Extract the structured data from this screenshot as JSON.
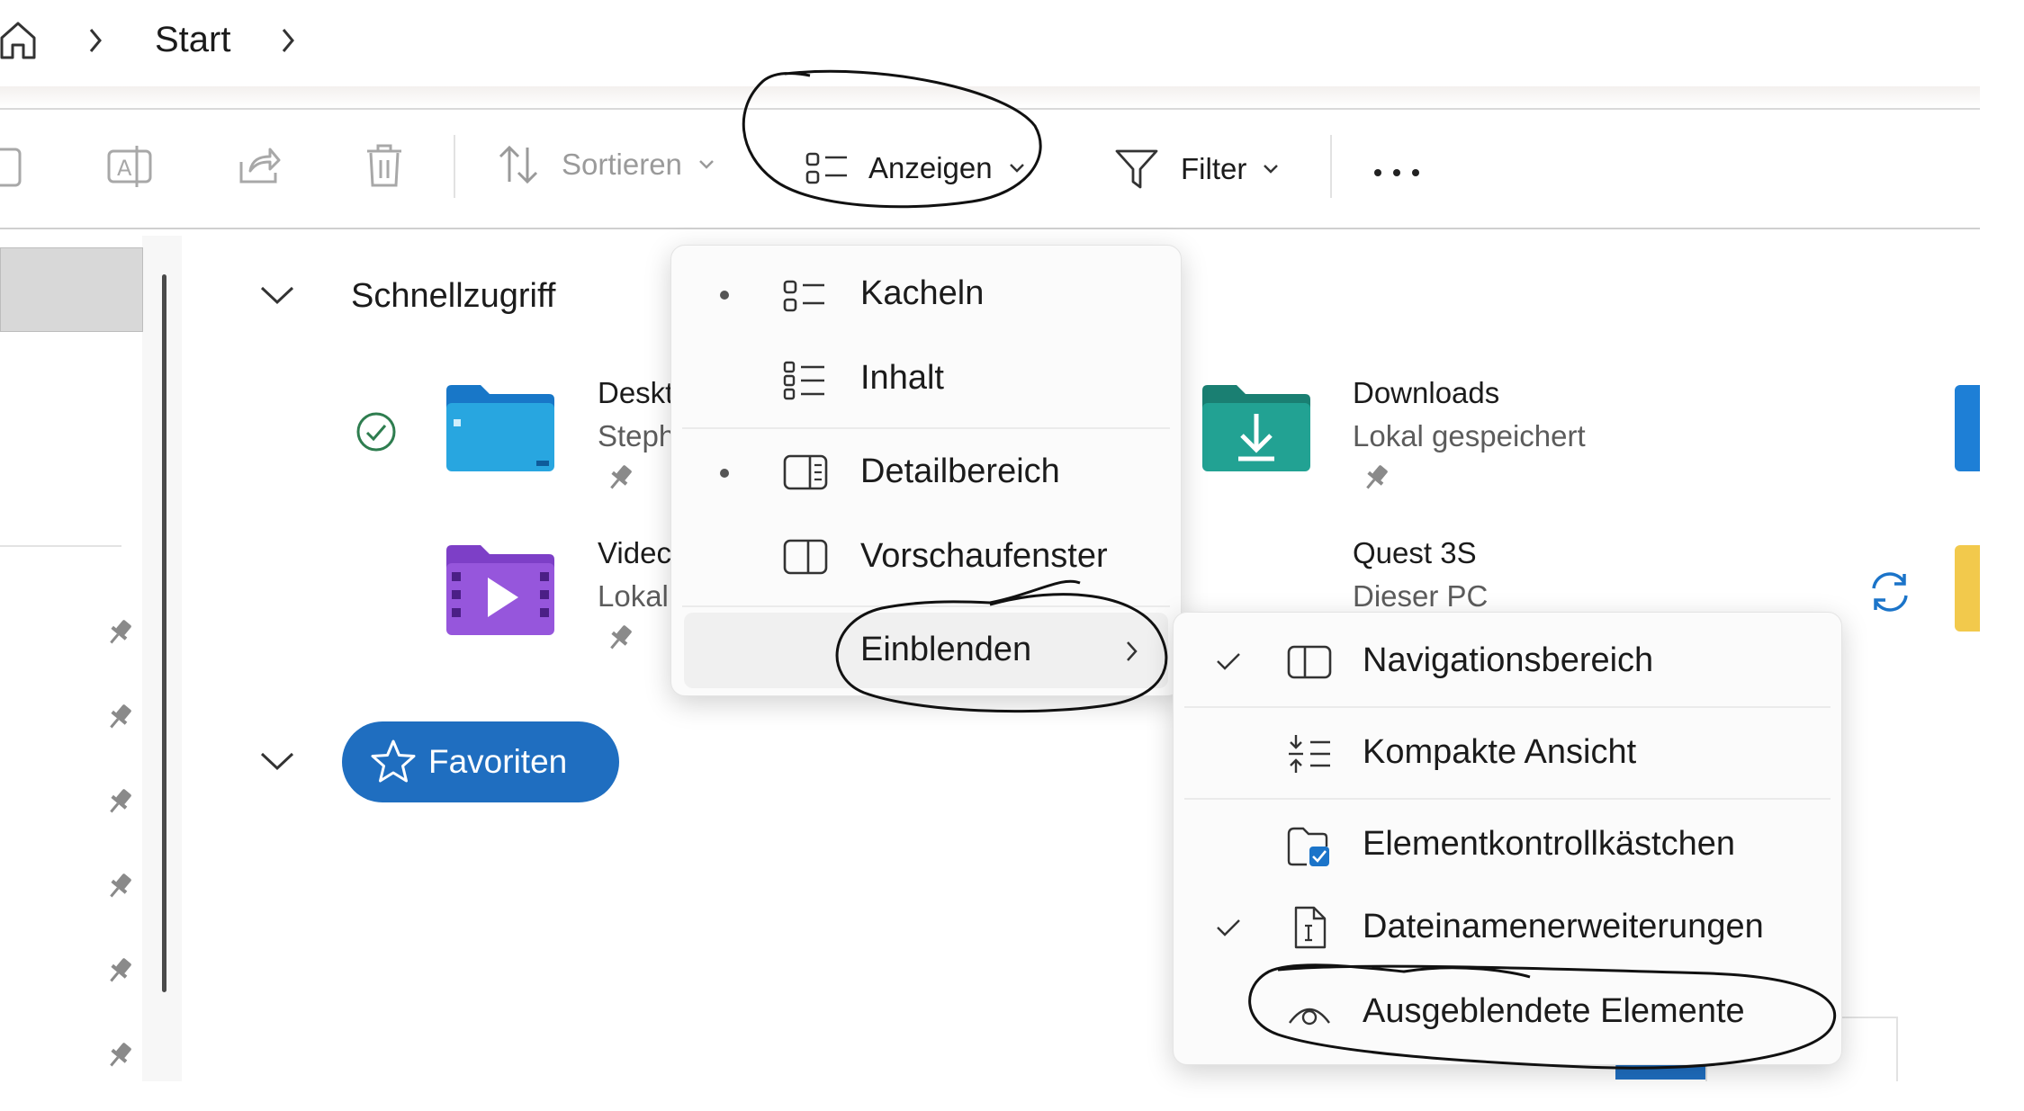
{
  "breadcrumb": {
    "home_icon": "home-icon",
    "items": [
      "Start"
    ]
  },
  "toolbar": {
    "sort_label": "Sortieren",
    "view_label": "Anzeigen",
    "filter_label": "Filter",
    "more_label": "…"
  },
  "main": {
    "quick_access": {
      "title": "Schnellzugriff",
      "items": [
        {
          "name": "Deskt",
          "sub": "Steph"
        },
        {
          "name": "Downloads",
          "sub": "Lokal gespeichert"
        },
        {
          "name": "Videc",
          "sub": "Lokal"
        },
        {
          "name": "Quest 3S",
          "sub": "Dieser PC"
        }
      ]
    },
    "favorites_label": "Favoriten"
  },
  "view_menu": {
    "items": [
      {
        "label": "Kacheln",
        "selected": true
      },
      {
        "label": "Inhalt",
        "selected": false
      },
      {
        "label": "Detailbereich",
        "selected": true
      },
      {
        "label": "Vorschaufenster",
        "selected": false
      },
      {
        "label": "Einblenden",
        "has_submenu": true
      }
    ]
  },
  "show_submenu": {
    "items": [
      {
        "label": "Navigationsbereich",
        "checked": true
      },
      {
        "label": "Kompakte Ansicht",
        "checked": false
      },
      {
        "label": "Elementkontrollkästchen",
        "checked": false
      },
      {
        "label": "Dateinamenerweiterungen",
        "checked": true
      },
      {
        "label": "Ausgeblendete Elemente",
        "checked": false
      }
    ]
  },
  "colors": {
    "accent": "#1f6ec0",
    "folder_blue": "#1e9ad6",
    "folder_teal": "#1f9e8e",
    "folder_purple": "#8a4fd8",
    "sync_blue": "#1b74c9"
  }
}
